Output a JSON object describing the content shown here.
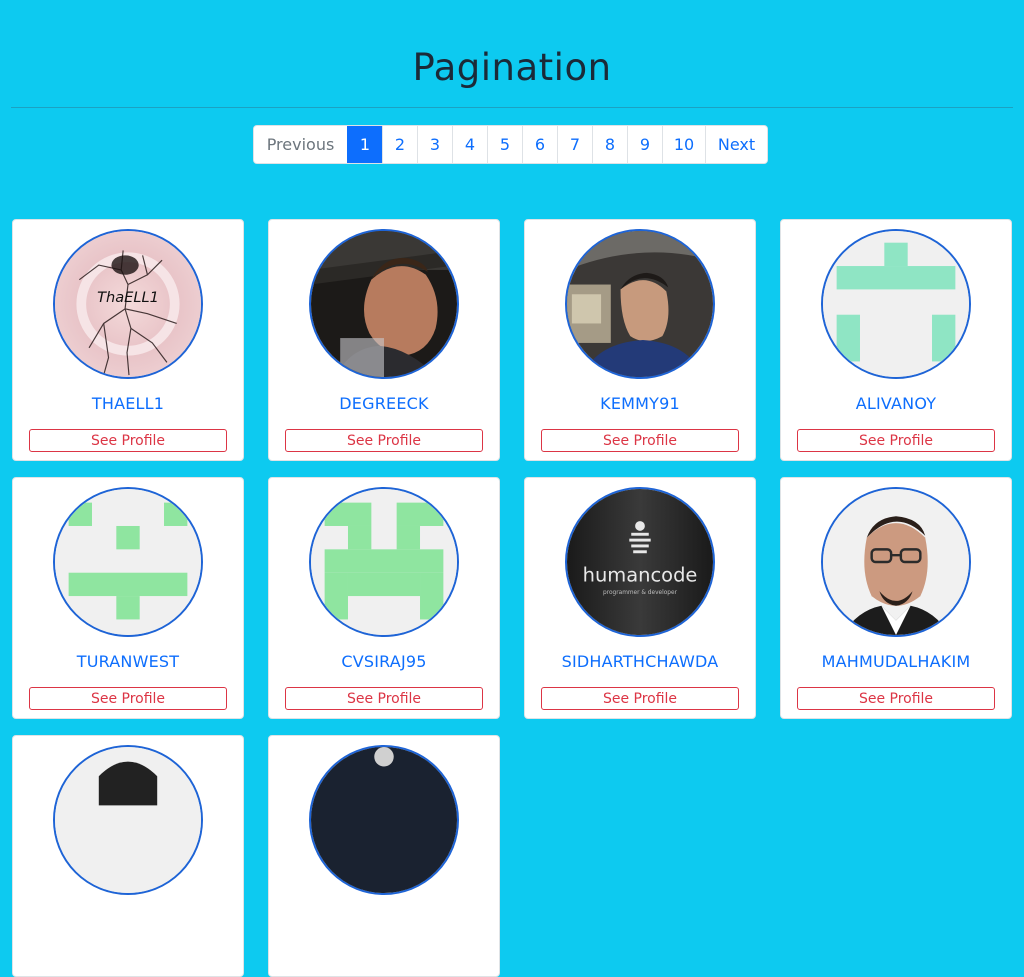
{
  "page": {
    "title": "Pagination"
  },
  "pagination": {
    "previous_label": "Previous",
    "next_label": "Next",
    "pages": [
      "1",
      "2",
      "3",
      "4",
      "5",
      "6",
      "7",
      "8",
      "9",
      "10"
    ],
    "active_page": "1"
  },
  "profiles": [
    {
      "username": "THAELL1",
      "button_label": "See Profile",
      "avatar_text": "ThaELL1"
    },
    {
      "username": "DEGREECK",
      "button_label": "See Profile"
    },
    {
      "username": "KEMMY91",
      "button_label": "See Profile"
    },
    {
      "username": "ALIVANOY",
      "button_label": "See Profile"
    },
    {
      "username": "TURANWEST",
      "button_label": "See Profile"
    },
    {
      "username": "CVSIRAJ95",
      "button_label": "See Profile"
    },
    {
      "username": "SIDHARTHCHAWDA",
      "button_label": "See Profile",
      "avatar_text": "humancode",
      "avatar_subtext": "programmer & developer"
    },
    {
      "username": "MAHMUDALHAKIM",
      "button_label": "See Profile"
    },
    {
      "username": "",
      "button_label": ""
    },
    {
      "username": "",
      "button_label": ""
    }
  ],
  "colors": {
    "background": "#0dcaf0",
    "primary": "#0d6efd",
    "danger": "#dc3545",
    "identicon_green": "#8fe5a0",
    "identicon_teal": "#8fe5c4"
  }
}
